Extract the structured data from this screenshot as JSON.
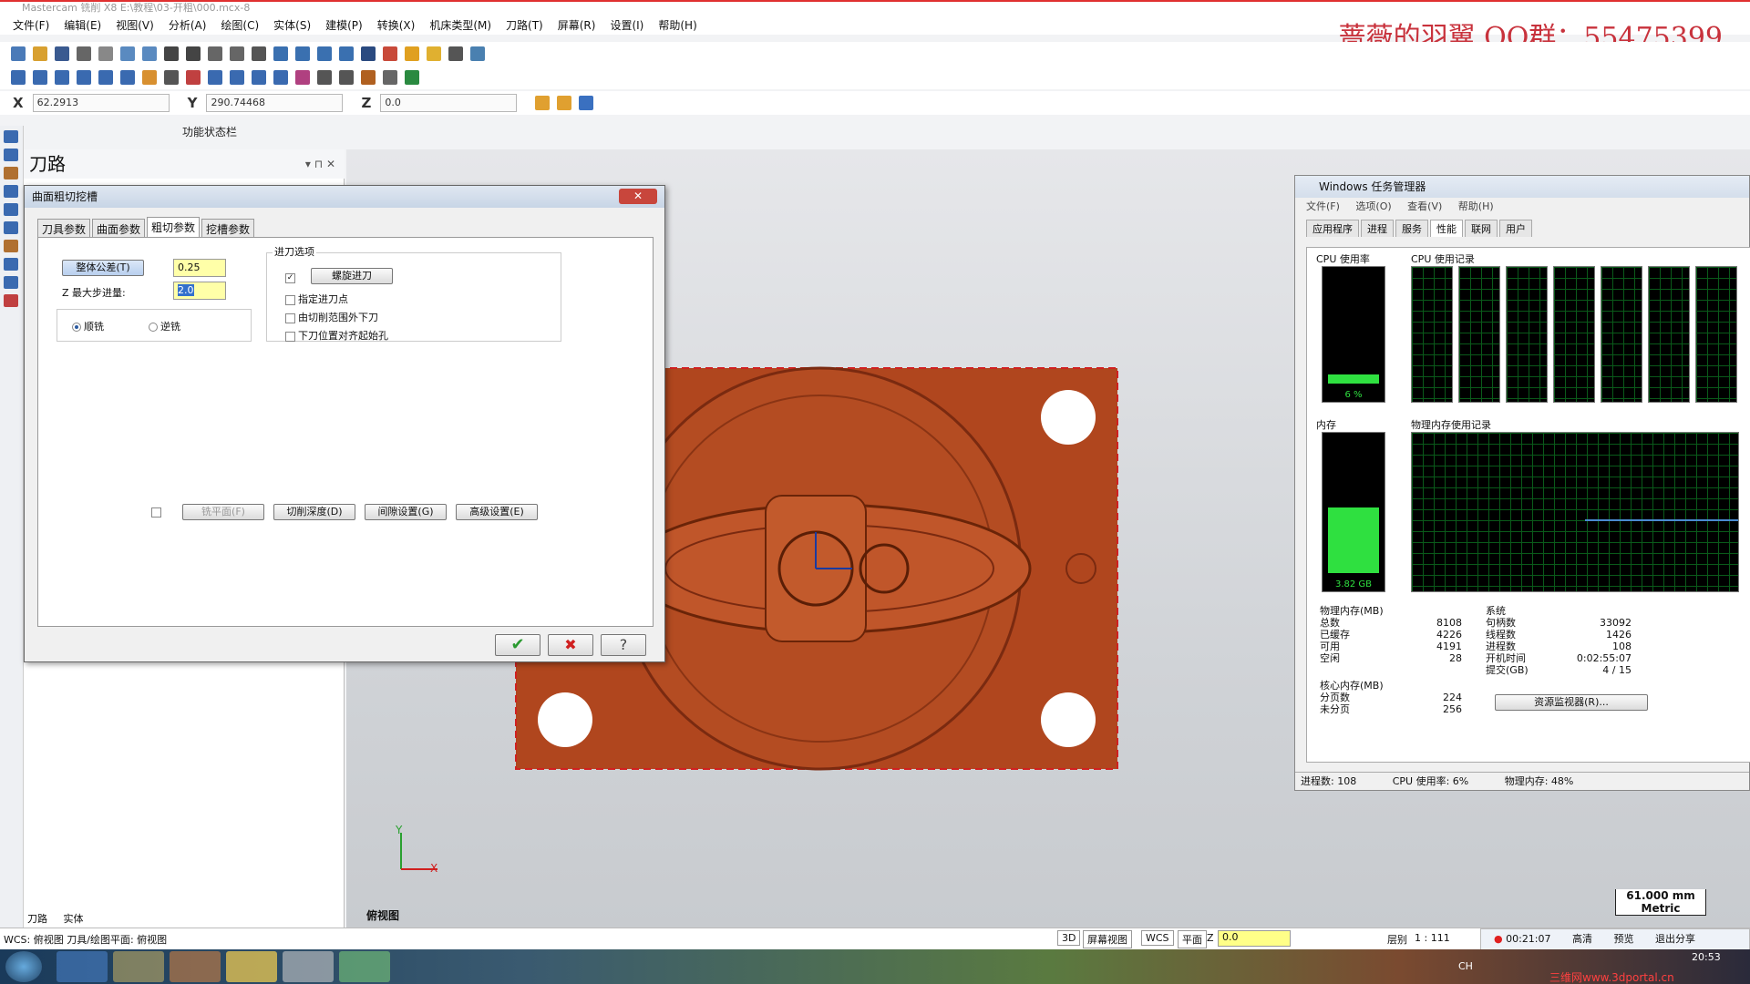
{
  "app": {
    "title": "Mastercam 铣削 X8  E:\\教程\\03-开粗\\000.mcx-8"
  },
  "watermark": "蔷薇的羽翼 QQ群：55475399",
  "menu": [
    "文件(F)",
    "编辑(E)",
    "视图(V)",
    "分析(A)",
    "绘图(C)",
    "实体(S)",
    "建模(P)",
    "转换(X)",
    "机床类型(M)",
    "刀路(T)",
    "屏幕(R)",
    "设置(I)",
    "帮助(H)"
  ],
  "coords": {
    "x_label": "X",
    "x": "62.2913",
    "y_label": "Y",
    "y": "290.74468",
    "z_label": "Z",
    "z": "0.0"
  },
  "function_status": "功能状态栏",
  "panel": {
    "title": "刀路",
    "tabs": [
      "刀路",
      "实体"
    ]
  },
  "dialog": {
    "title": "曲面粗切挖槽",
    "close": "✕",
    "tabs": [
      "刀具参数",
      "曲面参数",
      "粗切参数",
      "挖槽参数"
    ],
    "active_tab": 2,
    "tolerance_button": "整体公差(T)",
    "tolerance_value": "0.25",
    "zstep_label": "Z 最大步进量:",
    "zstep_value": "2.0",
    "climb": "顺铣",
    "conventional": "逆铣",
    "entry_group": "进刀选项",
    "helix_button": "螺旋进刀",
    "entry_opts": [
      "指定进刀点",
      "由切削范围外下刀",
      "下刀位置对齐起始孔"
    ],
    "buttons": [
      "铣平面(F)",
      "切削深度(D)",
      "间隙设置(G)",
      "高级设置(E)"
    ],
    "ok": "✔",
    "cancel": "✖",
    "help": "?"
  },
  "viewport": {
    "view_name": "俯视图",
    "axis_x": "X",
    "axis_y": "Y",
    "scale": "61.000 mm",
    "units": "Metric"
  },
  "taskmgr": {
    "title": "Windows 任务管理器",
    "menu": [
      "文件(F)",
      "选项(O)",
      "查看(V)",
      "帮助(H)"
    ],
    "tabs": [
      "应用程序",
      "进程",
      "服务",
      "性能",
      "联网",
      "用户"
    ],
    "active_tab": 3,
    "cpu_usage_label": "CPU 使用率",
    "cpu_usage": "6 %",
    "cpu_history_label": "CPU 使用记录",
    "mem_label": "内存",
    "mem_value": "3.82 GB",
    "mem_history_label": "物理内存使用记录",
    "phys_title": "物理内存(MB)",
    "phys": [
      [
        "总数",
        "8108"
      ],
      [
        "已缓存",
        "4226"
      ],
      [
        "可用",
        "4191"
      ],
      [
        "空闲",
        "28"
      ]
    ],
    "kernel_title": "核心内存(MB)",
    "kernel": [
      [
        "分页数",
        "224"
      ],
      [
        "未分页",
        "256"
      ]
    ],
    "sys_title": "系统",
    "sys": [
      [
        "句柄数",
        "33092"
      ],
      [
        "线程数",
        "1426"
      ],
      [
        "进程数",
        "108"
      ],
      [
        "开机时间",
        "0:02:55:07"
      ],
      [
        "提交(GB)",
        "4 / 15"
      ]
    ],
    "resmon": "资源监视器(R)...",
    "status": [
      "进程数: 108",
      "CPU 使用率: 6%",
      "物理内存: 48%"
    ]
  },
  "bottombar": {
    "status": "WCS: 俯视图  刀具/绘图平面: 俯视图",
    "items": [
      "3D",
      "屏幕视图",
      "WCS",
      "平面"
    ],
    "z_label": "Z",
    "z": "0.0",
    "layer": "层别",
    "scale": "1 : 111",
    "rec_time": "00:21:07",
    "rec_buttons": [
      "高清",
      "预览",
      "退出分享"
    ]
  },
  "tray": {
    "time": "20:53",
    "lang": "CH",
    "site": "三维网www.3dportal.cn"
  }
}
